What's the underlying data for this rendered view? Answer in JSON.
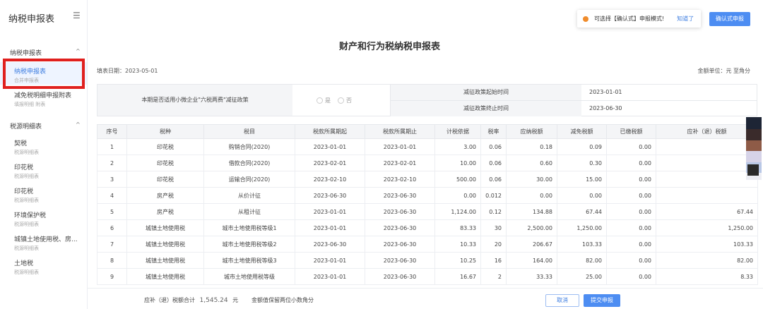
{
  "sidebar": {
    "logo": "纳税申报表",
    "menu_icon": "hamburger-icon",
    "group1": {
      "title": "纳税申报表",
      "caret": "^"
    },
    "group1_items": [
      {
        "label": "纳税申报表",
        "sub": "合并申报表"
      },
      {
        "label": "减免税明细申报附表",
        "sub": "填报明细 附表"
      }
    ],
    "group2": {
      "title": "税源明细表",
      "caret": "^"
    },
    "group2_items": [
      {
        "label": "契税",
        "sub": "税源明细表"
      },
      {
        "label": "印花税",
        "sub": "税源明细表"
      },
      {
        "label": "印花税",
        "sub": "税源明细表"
      },
      {
        "label": "环境保护税",
        "sub": "税源明细表"
      },
      {
        "label": "城镇土地使用税、房...",
        "sub": "税源明细表"
      },
      {
        "label": "土地税",
        "sub": "税源明细表"
      }
    ]
  },
  "notice": {
    "text": "可选择【确认式】申报模式!",
    "link": "知道了",
    "dot_color": "#f08c2c"
  },
  "confirm_button": "确认式申报",
  "page_title": "财产和行为税纳税申报表",
  "date_line": "填表日期：2023-05-01",
  "unit_line": "金额单位：元 至角分",
  "policy": {
    "question": "本期是否适用小微企业\"六税两费\"减征政策",
    "options": [
      "是",
      "否"
    ],
    "rows": [
      {
        "key": "减征政策起始时间",
        "value": "2023-01-01"
      },
      {
        "key": "减征政策终止时间",
        "value": "2023-06-30"
      }
    ]
  },
  "table": {
    "headers": [
      "序号",
      "税种",
      "税目",
      "税款所属期起",
      "税款所属期止",
      "计税依据",
      "税率",
      "应纳税额",
      "减免税额",
      "已缴税额",
      "应补（退）税额"
    ],
    "rows": [
      [
        "1",
        "印花税",
        "购销合同(2020)",
        "2023-01-01",
        "2023-01-01",
        "3.00",
        "0.06",
        "0.18",
        "0.09",
        "0.00",
        ""
      ],
      [
        "2",
        "印花税",
        "借款合同(2020)",
        "2023-02-01",
        "2023-02-01",
        "10.00",
        "0.06",
        "0.60",
        "0.30",
        "0.00",
        ""
      ],
      [
        "3",
        "印花税",
        "运输合同(2020)",
        "2023-02-10",
        "2023-02-10",
        "500.00",
        "0.06",
        "30.00",
        "15.00",
        "0.00",
        ""
      ],
      [
        "4",
        "房产税",
        "从价计征",
        "2023-06-30",
        "2023-06-30",
        "0.00",
        "0.012",
        "0.00",
        "0.00",
        "0.00",
        ""
      ],
      [
        "5",
        "房产税",
        "从租计征",
        "2023-01-01",
        "2023-06-30",
        "1,124.00",
        "0.12",
        "134.88",
        "67.44",
        "0.00",
        "67.44"
      ],
      [
        "6",
        "城镇土地使用税",
        "城市土地使用税等级1",
        "2023-01-01",
        "2023-06-30",
        "83.33",
        "30",
        "2,500.00",
        "1,250.00",
        "0.00",
        "1,250.00"
      ],
      [
        "7",
        "城镇土地使用税",
        "城市土地使用税等级2",
        "2023-06-30",
        "2023-06-30",
        "10.33",
        "20",
        "206.67",
        "103.33",
        "0.00",
        "103.33"
      ],
      [
        "8",
        "城镇土地使用税",
        "城市土地使用税等级3",
        "2023-01-01",
        "2023-06-30",
        "10.25",
        "16",
        "164.00",
        "82.00",
        "0.00",
        "82.00"
      ],
      [
        "9",
        "城镇土地使用税",
        "城市土地使用税等级",
        "2023-01-01",
        "2023-06-30",
        "16.67",
        "2",
        "33.33",
        "25.00",
        "0.00",
        "8.33"
      ]
    ]
  },
  "swatches": [
    "#1d2535",
    "#3a2b2b",
    "#8e5b47",
    "#d6d3e8",
    "#b9c8e6",
    "#edeef4",
    "#2a2a2a"
  ],
  "footer": {
    "total_label": "应补（退）税额合计",
    "total_amount": "1,545.24",
    "unit": "元",
    "note": "金额值保留两位小数角分",
    "cancel": "取消",
    "submit": "提交申报"
  }
}
